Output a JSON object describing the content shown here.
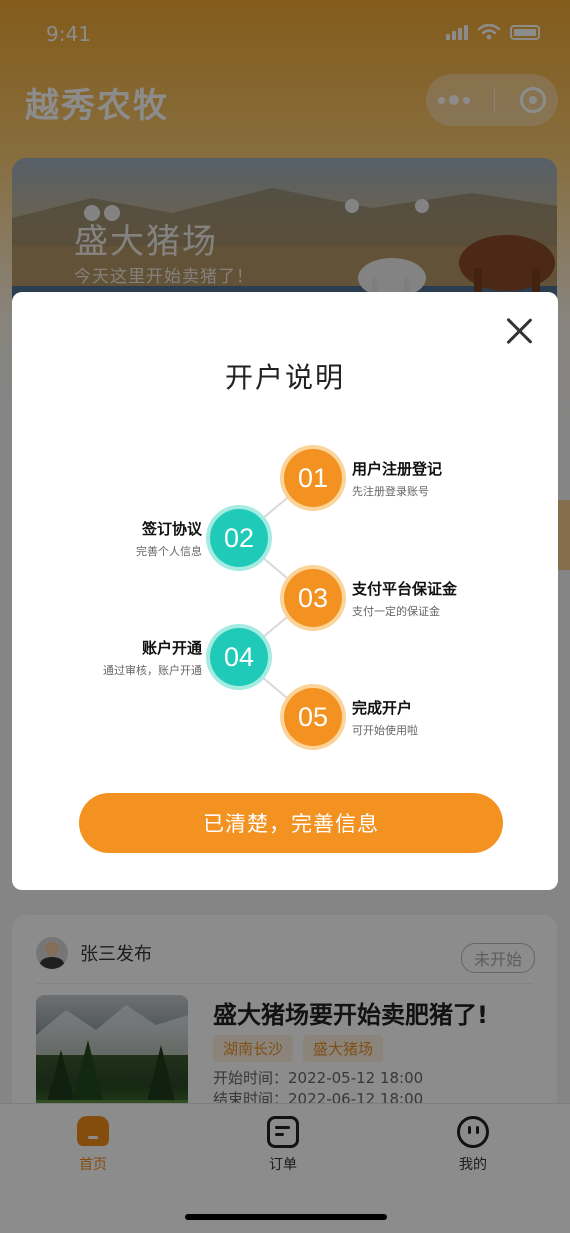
{
  "status_bar": {
    "time": "9:41"
  },
  "app": {
    "title": "越秀农牧"
  },
  "banner": {
    "title": "盛大猪场",
    "subtitle": "今天这里开始卖猪了！"
  },
  "post": {
    "poster": "张三发布",
    "status": "未开始",
    "title": "盛大猪场要开始卖肥猪了!",
    "tags": [
      "湖南长沙",
      "盛大猪场"
    ],
    "start_label": "开始时间：",
    "start_value": "2022-05-12   18:00",
    "end_label": "结束时间：",
    "end_value": "2022-06-12   18:00"
  },
  "tabbar": {
    "home": "首页",
    "orders": "订单",
    "mine": "我的"
  },
  "modal": {
    "title": "开户说明",
    "steps": [
      {
        "num": "01",
        "title": "用户注册登记",
        "desc": "先注册登录账号",
        "color": "#f39221"
      },
      {
        "num": "02",
        "title": "签订协议",
        "desc": "完善个人信息",
        "color": "#1fcbb8"
      },
      {
        "num": "03",
        "title": "支付平台保证金",
        "desc": "支付一定的保证金",
        "color": "#f39221"
      },
      {
        "num": "04",
        "title": "账户开通",
        "desc": "通过审核，账户开通",
        "color": "#1fcbb8"
      },
      {
        "num": "05",
        "title": "完成开户",
        "desc": "可开始使用啦",
        "color": "#f39221"
      }
    ],
    "confirm_label": "已清楚，完善信息"
  },
  "colors": {
    "accent": "#f39221",
    "teal": "#1fcbb8"
  }
}
